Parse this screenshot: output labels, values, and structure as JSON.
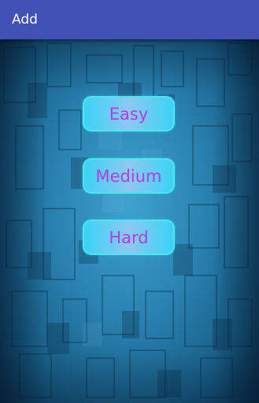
{
  "action_bar": {
    "title": "Add",
    "color": "#3f51b5"
  },
  "buttons": {
    "easy": "Easy",
    "medium": "Medium",
    "hard": "Hard",
    "text_color": "#b03ee0",
    "border_color": "#4fe6f2"
  },
  "background": {
    "description_colors": [
      "#1b6f98",
      "#0c3a5a"
    ]
  }
}
